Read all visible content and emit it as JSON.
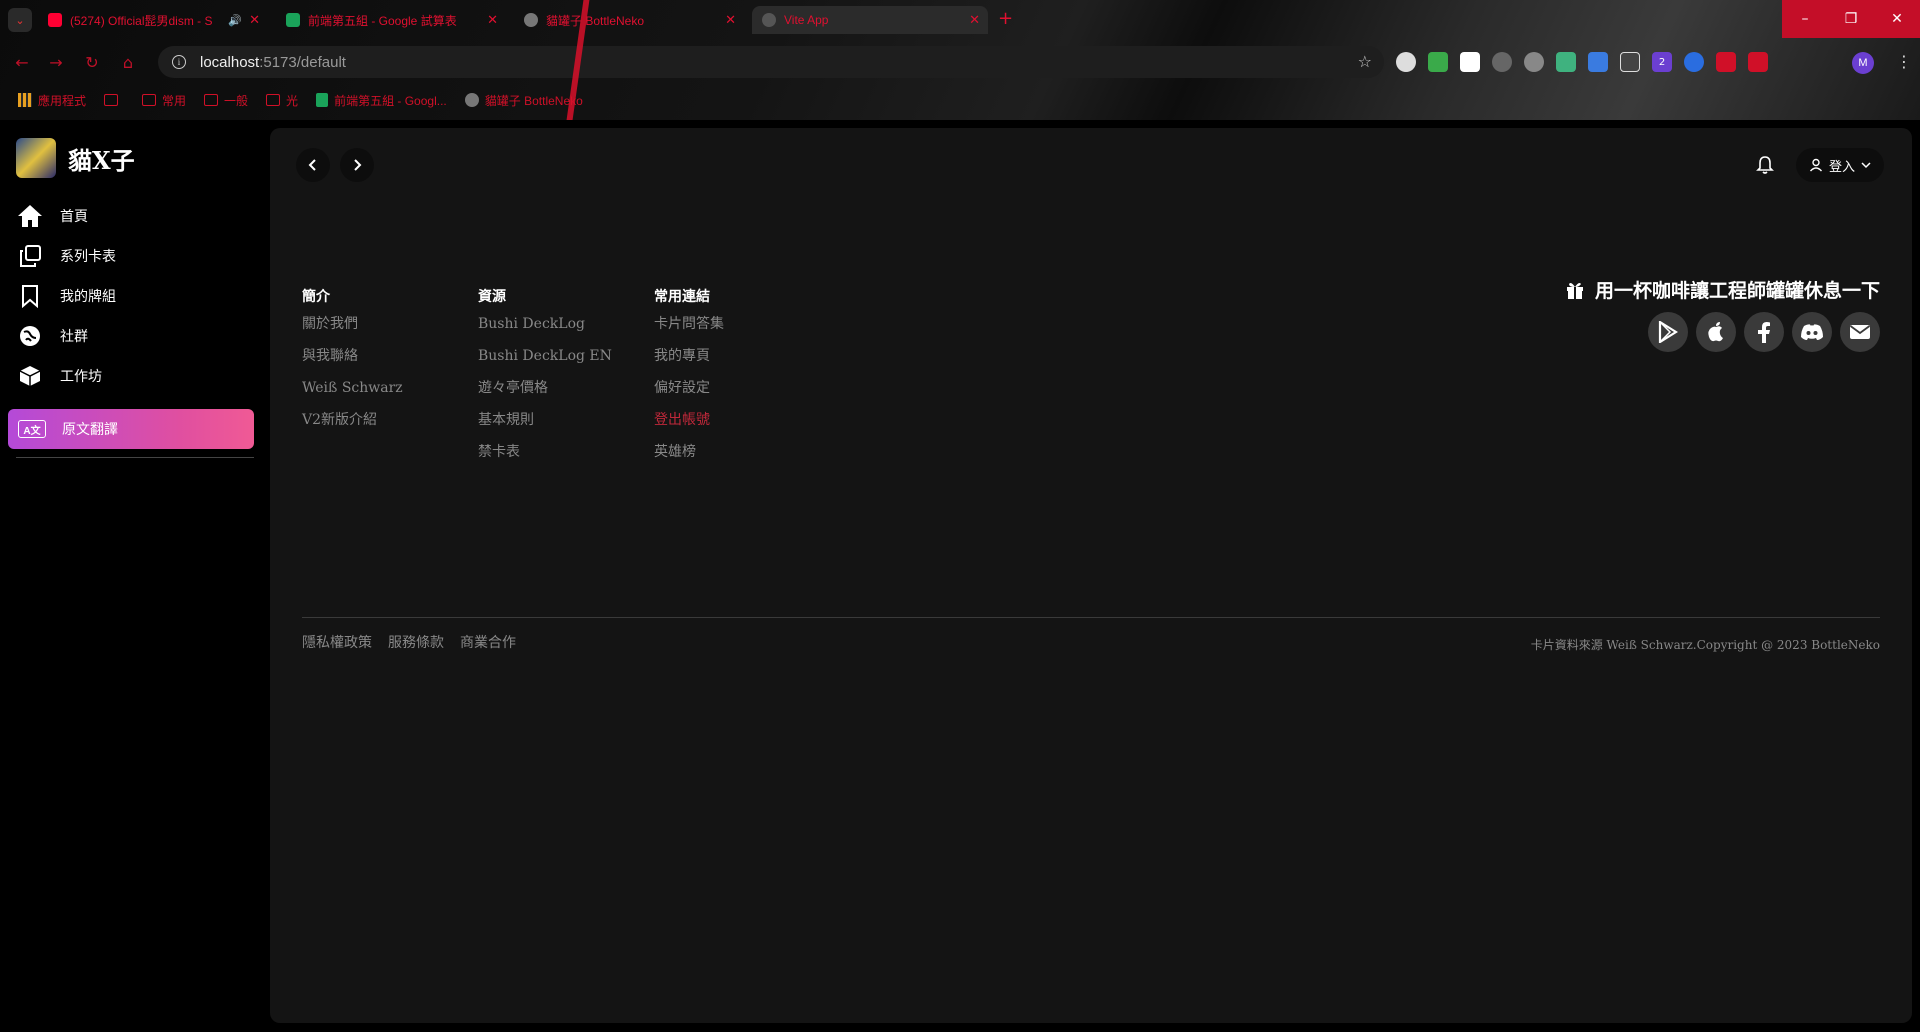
{
  "browser": {
    "tabs": [
      {
        "title": "(5274) Official髭男dism - S",
        "favicon": "youtube-icon",
        "color": "#ff0033"
      },
      {
        "title": "前端第五組 - Google 試算表",
        "favicon": "sheets-icon",
        "color": "#1aa35a"
      },
      {
        "title": "貓罐子 BottleNeko",
        "favicon": "bottleneko-icon",
        "color": "#777777"
      },
      {
        "title": "Vite App",
        "favicon": "globe-icon",
        "color": "#555555"
      }
    ],
    "new_tab": "+",
    "url_host": "localhost",
    "url_path": ":5173/default",
    "profile_initial": "M",
    "ext_badge": "2",
    "bookmarks": [
      {
        "label": "應用程式",
        "kind": "grid"
      },
      {
        "label": "",
        "kind": "sheet-small"
      },
      {
        "label": "常用",
        "kind": "folder"
      },
      {
        "label": "一般",
        "kind": "folder"
      },
      {
        "label": "光",
        "kind": "folder"
      },
      {
        "label": "前端第五組 - Googl...",
        "kind": "sheet"
      },
      {
        "label": "貓罐子 BottleNeko",
        "kind": "cat"
      }
    ],
    "window": {
      "minimize": "–",
      "restore": "❐",
      "close": "✕"
    }
  },
  "sidebar": {
    "brand": "貓X子",
    "items": [
      {
        "label": "首頁",
        "icon": "home-icon"
      },
      {
        "label": "系列卡表",
        "icon": "copy-icon"
      },
      {
        "label": "我的牌組",
        "icon": "bookmark-icon"
      },
      {
        "label": "社群",
        "icon": "globe-icon"
      },
      {
        "label": "工作坊",
        "icon": "box-icon"
      }
    ],
    "translate": {
      "label": "原文翻譯",
      "badge": "A文"
    }
  },
  "header": {
    "login": "登入"
  },
  "footer": {
    "columns": [
      {
        "title": "簡介",
        "links": [
          "關於我們",
          "與我聯絡",
          "Weiß Schwarz",
          "V2新版介紹"
        ]
      },
      {
        "title": "資源",
        "links": [
          "Bushi DeckLog",
          "Bushi DeckLog EN",
          "遊々亭價格",
          "基本規則",
          "禁卡表"
        ]
      },
      {
        "title": "常用連結",
        "links": [
          "卡片問答集",
          "我的專頁",
          "偏好設定",
          "登出帳號",
          "英雄榜"
        ]
      }
    ],
    "coffee": "用一杯咖啡讓工程師罐罐休息一下",
    "socials": [
      "google-play-icon",
      "apple-icon",
      "facebook-icon",
      "discord-icon",
      "email-icon"
    ],
    "legal": [
      "隱私權政策",
      "服務條款",
      "商業合作"
    ],
    "copyright": "卡片資料來源 Weiß Schwarz.Copyright @ 2023 BottleNeko"
  },
  "colors": {
    "accent_from": "#b44ad8",
    "accent_to": "#f05a95",
    "danger": "#c0283a"
  }
}
